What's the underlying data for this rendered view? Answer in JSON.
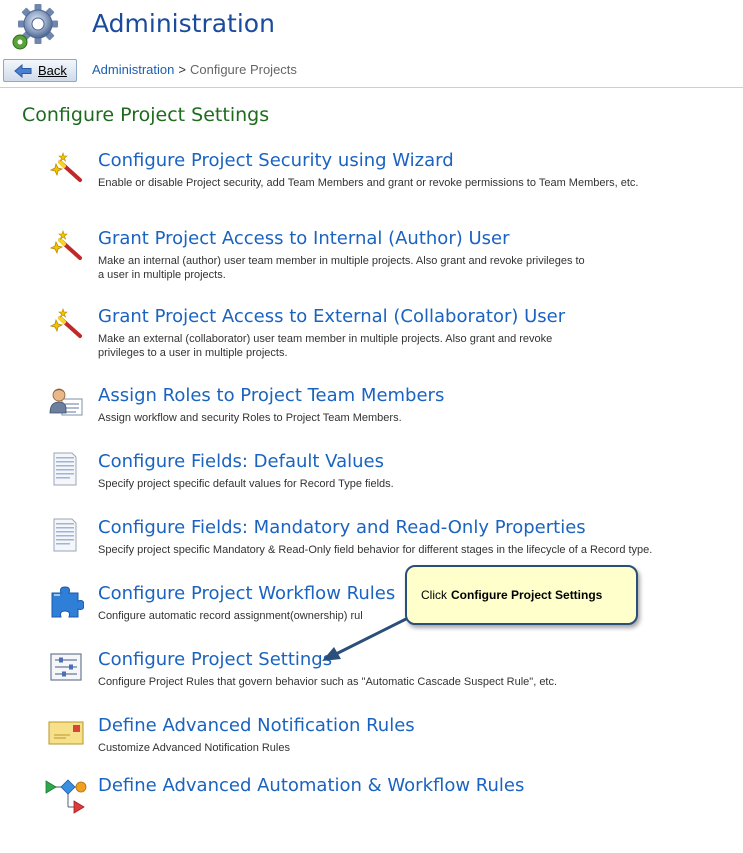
{
  "header": {
    "title": "Administration",
    "back_label": "Back",
    "breadcrumb": {
      "link": "Administration",
      "separator": ">",
      "current": "Configure Projects"
    }
  },
  "section_title": "Configure Project Settings",
  "items": [
    {
      "icon": "wand-icon",
      "title": "Configure Project Security using Wizard",
      "desc": "Enable or disable Project security, add Team Members and grant or revoke permissions to Team Members, etc."
    },
    {
      "icon": "wand-icon",
      "title": "Grant Project Access to Internal (Author) User",
      "desc": "Make an internal (author) user team member in multiple projects. Also grant and revoke privileges to a user in multiple projects."
    },
    {
      "icon": "wand-icon",
      "title": "Grant Project Access to External (Collaborator) User",
      "desc": "Make an external (collaborator) user team member in multiple projects. Also grant and revoke privileges to a user in multiple projects."
    },
    {
      "icon": "user-card-icon",
      "title": "Assign Roles to Project Team Members",
      "desc": "Assign workflow and security Roles to Project Team Members."
    },
    {
      "icon": "document-icon",
      "title": "Configure Fields: Default Values",
      "desc": "Specify project specific default values for Record Type fields."
    },
    {
      "icon": "document-icon",
      "title": "Configure Fields: Mandatory and Read-Only Properties",
      "desc": "Specify project specific Mandatory & Read-Only field behavior for different stages in the lifecycle of a Record type."
    },
    {
      "icon": "puzzle-icon",
      "title": "Configure Project Workflow Rules",
      "desc": "Configure automatic record assignment(ownership) rul"
    },
    {
      "icon": "settings-sliders-icon",
      "title": "Configure Project Settings",
      "desc": "Configure Project Rules that govern behavior such as \"Automatic Cascade Suspect Rule\", etc."
    },
    {
      "icon": "envelope-icon",
      "title": "Define Advanced Notification Rules",
      "desc": "Customize Advanced Notification Rules"
    },
    {
      "icon": "workflow-diagram-icon",
      "title": "Define Advanced Automation & Workflow Rules",
      "desc": ""
    }
  ],
  "callout": {
    "prefix": "Click",
    "bold": "Configure Project Settings"
  },
  "colors": {
    "title_blue": "#1a63c0",
    "section_green": "#1e6b1e",
    "callout_bg": "#ffffcc",
    "callout_border": "#2a4f7a"
  }
}
